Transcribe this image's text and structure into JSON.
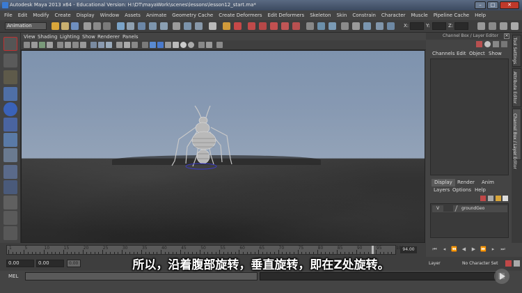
{
  "window": {
    "title": "Autodesk Maya 2013 x64 - Educational Version: H:\\DT\\mayaWork\\scenes\\lessons\\lesson12_start.ma*",
    "minimize": "–",
    "maximize": "□",
    "close": "✕"
  },
  "menubar": [
    "File",
    "Edit",
    "Modify",
    "Create",
    "Display",
    "Window",
    "Assets",
    "Animate",
    "Geometry Cache",
    "Create Deformers",
    "Edit Deformers",
    "Skeleton",
    "Skin",
    "Constrain",
    "Character",
    "Muscle",
    "Pipeline Cache",
    "Help"
  ],
  "statusline": {
    "mode": "Animation",
    "x_label": "X:",
    "y_label": "Y:",
    "z_label": "Z:"
  },
  "panel_menu": [
    "View",
    "Shading",
    "Lighting",
    "Show",
    "Renderer",
    "Panels"
  ],
  "channel_box": {
    "header": "Channel Box / Layer Editor",
    "menu": [
      "Channels",
      "Edit",
      "Object",
      "Show"
    ]
  },
  "side_tabs": [
    "Tool Settings",
    "Attribute Editor",
    "Channel Box / Layer Editor"
  ],
  "layer_editor": {
    "tabs": [
      "Display",
      "Render",
      "Anim"
    ],
    "menu": [
      "Layers",
      "Options",
      "Help"
    ],
    "row": {
      "visibility": "V",
      "name": "groundGeo"
    }
  },
  "time_slider": {
    "ticks": [
      "1",
      "5",
      "10",
      "15",
      "20",
      "25",
      "30",
      "35",
      "40",
      "45",
      "50",
      "55",
      "60",
      "65",
      "70",
      "75",
      "80",
      "85",
      "90",
      "95",
      "100"
    ],
    "current_frame": "94.00",
    "playhead_label": "94"
  },
  "range_slider": {
    "start": "0.00",
    "inner_start": "0.00",
    "range_label": "0.00",
    "anim_layer": "Layer",
    "character_set": "No Character Set"
  },
  "command_line": {
    "label": "MEL"
  },
  "subtitle": "所以，沿着腹部旋转，垂直旋转，即在Z处旋转。"
}
